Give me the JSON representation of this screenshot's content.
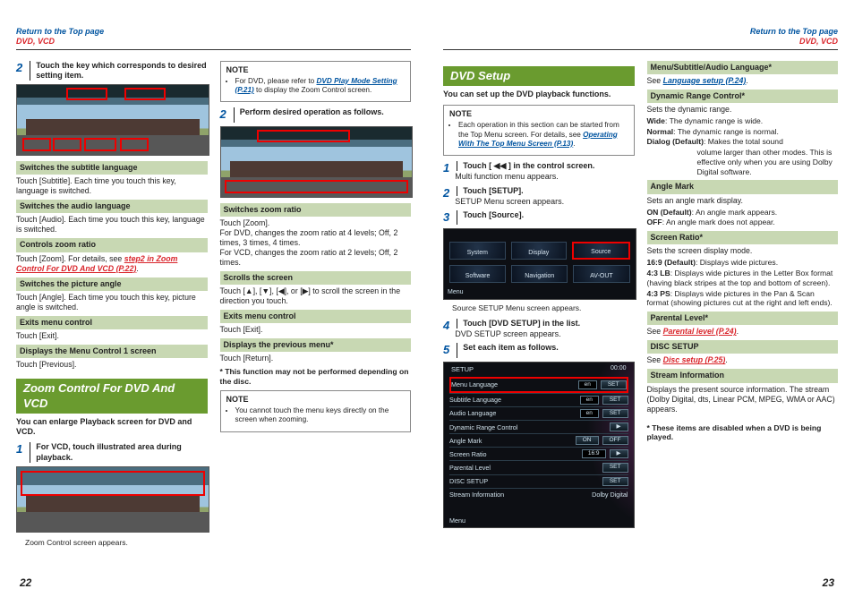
{
  "header": {
    "top": "Return to the Top page",
    "crumb": "DVD, VCD"
  },
  "pagenum": {
    "l": "22",
    "r": "23"
  },
  "col1": {
    "step2": "Touch the key which corresponds to desired setting item.",
    "sub1": "Switches the subtitle language",
    "sub1t": "Touch [Subtitle]. Each time you touch this key, language is switched.",
    "sub2": "Switches the audio language",
    "sub2t": "Touch [Audio]. Each time you touch this key, language is switched.",
    "sub3": "Controls zoom ratio",
    "sub3t_a": "Touch [Zoom]. For details, see ",
    "sub3t_link": "step2 in Zoom Control For DVD And VCD (P.22)",
    "sub4": "Switches the picture angle",
    "sub4t": "Touch [Angle]. Each time you touch this key, picture angle is switched.",
    "sub5": "Exits menu control",
    "sub5t": "Touch [Exit].",
    "sub6": "Displays the Menu Control 1 screen",
    "sub6t": "Touch [Previous].",
    "sect": "Zoom Control For DVD And VCD",
    "intro": "You can enlarge Playback screen for DVD and VCD.",
    "step1": "For VCD, touch illustrated area during playback.",
    "cap": "Zoom Control screen appears."
  },
  "col2": {
    "note_t": "NOTE",
    "note_li1a": "For DVD, please refer to ",
    "note_li1link": "DVD Play Mode Setting (P.21)",
    "note_li1b": " to display the Zoom Control screen.",
    "step2": "Perform desired operation as follows.",
    "s1": "Switches zoom ratio",
    "s1t": "Touch [Zoom].\nFor DVD, changes the zoom ratio at 4 levels; Off, 2 times, 3 times, 4 times.\nFor VCD, changes the zoom ratio at 2 levels; Off, 2 times.",
    "s2": "Scrolls the screen",
    "s2t": "Touch [▲], [▼], [◀], or [▶] to scroll the screen in the direction you touch.",
    "s3": "Exits menu control",
    "s3t": "Touch [Exit].",
    "s4": "Displays the previous menu*",
    "s4t": "Touch [Return].",
    "foot": "* This function may not be performed depending on the disc.",
    "note2": "You cannot touch the menu keys directly on the screen when zooming."
  },
  "col3": {
    "sect": "DVD Setup",
    "intro": "You can set up the DVD playback functions.",
    "note_t": "NOTE",
    "note_li": "Each operation in this section can be started from the Top Menu screen. For details, see ",
    "note_link": "Operating With The Top Menu Screen (P.13)",
    "s1": "Touch [ ◀◀ ] in the control screen.",
    "s1d": "Multi function menu appears.",
    "s2": "Touch [SETUP].",
    "s2d": "SETUP Menu screen appears.",
    "s3": "Touch [Source].",
    "setup_cells": [
      "System",
      "Display",
      "Source",
      "Software",
      "Navigation",
      "AV-OUT"
    ],
    "setup_menu": "Menu",
    "s3d": "Source SETUP Menu screen appears.",
    "s4": "Touch [DVD SETUP] in the list.",
    "s4d": "DVD SETUP screen appears.",
    "s5": "Set each item as follows.",
    "dvd": {
      "title": "SETUP",
      "time": "00:00",
      "rows": [
        {
          "k": "Menu Language",
          "v": "en",
          "set": true
        },
        {
          "k": "Subtitle Language",
          "v": "en",
          "set": true
        },
        {
          "k": "Audio Language",
          "v": "en",
          "set": true
        },
        {
          "k": "Dynamic Range Control",
          "v": "",
          "arrow": true
        },
        {
          "k": "Angle Mark",
          "v": "",
          "onoff": true
        },
        {
          "k": "Screen Ratio",
          "v": "16:9",
          "arrow": true
        },
        {
          "k": "Parental Level",
          "v": "",
          "set": true
        },
        {
          "k": "DISC SETUP",
          "v": "",
          "set": true
        },
        {
          "k": "Stream Information",
          "v": "Dolby Digital",
          "plain": true
        }
      ],
      "menu": "Menu"
    }
  },
  "col4": {
    "h1": "Menu/Subtitle/Audio Language*",
    "h1t_a": "See ",
    "h1link": "Language setup (P.24)",
    "h2": "Dynamic Range Control*",
    "h2t": "Sets the dynamic range.",
    "h2a": "Wide",
    "h2at": ": The dynamic range is wide.",
    "h2b": "Normal",
    "h2bt": ": The dynamic range is normal.",
    "h2c": "Dialog (Default)",
    "h2ct": ": Makes the total sound volume larger than other modes. This is effective only when you are using Dolby Digital software.",
    "h3": "Angle Mark",
    "h3t": "Sets an angle mark display.",
    "h3a": "ON (Default)",
    "h3at": ": An angle mark appears.",
    "h3b": "OFF",
    "h3bt": ": An angle mark does not appear.",
    "h4": "Screen Ratio*",
    "h4t": "Sets the screen display mode.",
    "h4a": "16:9 (Default)",
    "h4at": ": Displays wide pictures.",
    "h4b": "4:3 LB",
    "h4bt": ": Displays wide pictures in the Letter Box format (having black stripes at the top and bottom of screen).",
    "h4c": "4:3 PS",
    "h4ct": ": Displays wide pictures in the Pan & Scan format (showing pictures cut at the right and left ends).",
    "h5": "Parental Level*",
    "h5t_a": "See ",
    "h5link": "Parental level (P.24)",
    "h6": "DISC SETUP",
    "h6t_a": "See ",
    "h6link": "Disc setup (P.25)",
    "h7": "Stream Information",
    "h7t": "Displays the present source information. The stream (Dolby Digital, dts, Linear PCM, MPEG, WMA or AAC) appears.",
    "foot": "* These items are disabled when a DVD is being played."
  }
}
